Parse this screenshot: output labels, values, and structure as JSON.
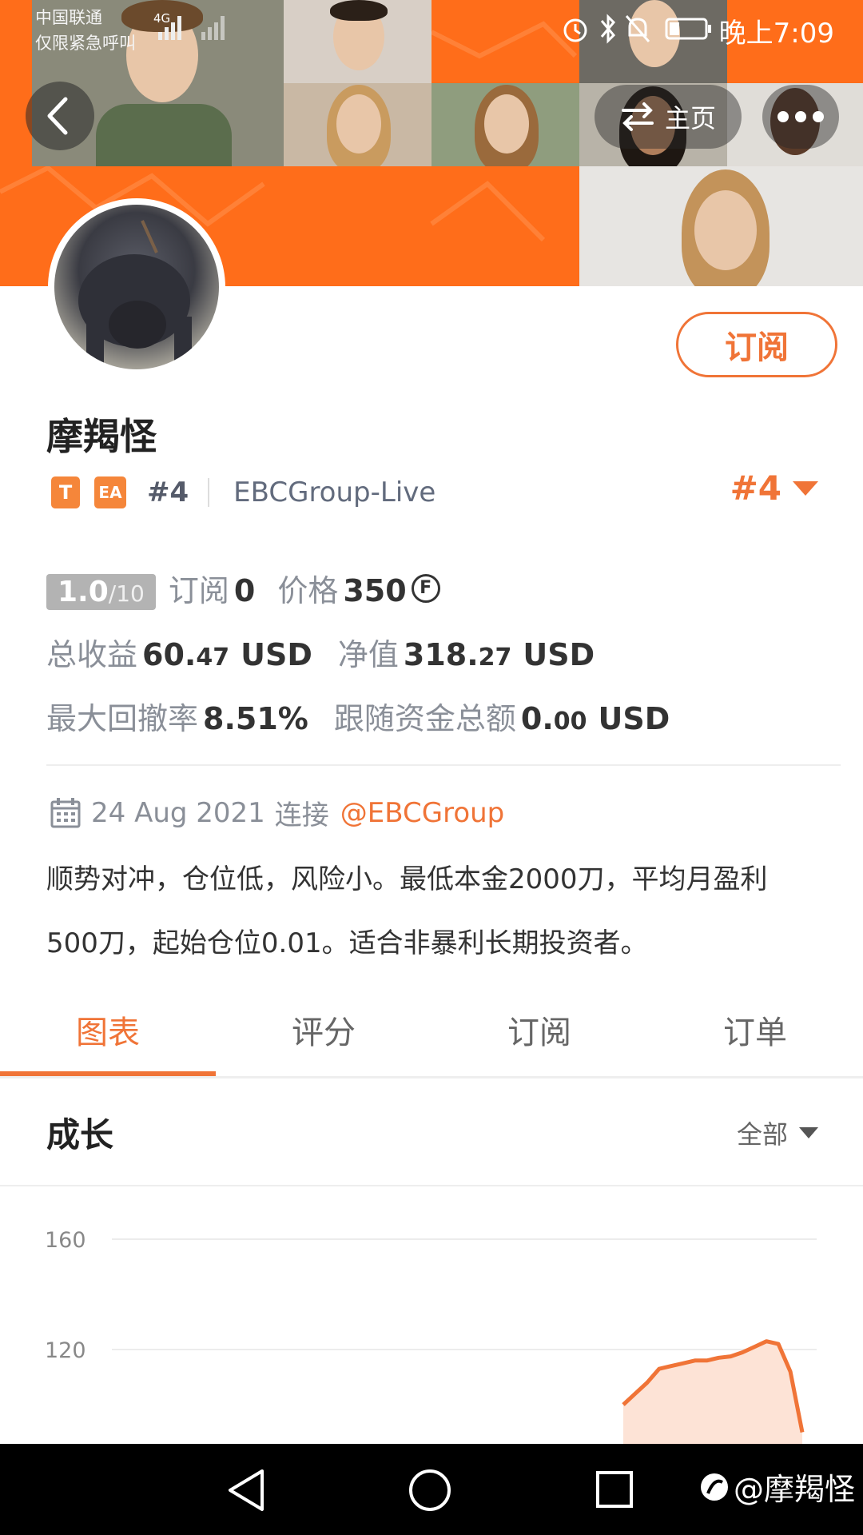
{
  "status_bar": {
    "carrier": "中国联通",
    "emergency": "仅限紧急呼叫",
    "network": "4G",
    "time": "晚上7:09"
  },
  "header": {
    "home_label": "主页"
  },
  "profile": {
    "name": "摩羯怪",
    "badge_t": "T",
    "badge_ea": "EA",
    "rank_small": "#4",
    "server": "EBCGroup-Live",
    "rank_big": "#4",
    "subscribe_label": "订阅"
  },
  "stats": {
    "rating_value": "1.0",
    "rating_max": "/10",
    "subs_label": "订阅",
    "subs_value": "0",
    "price_label": "价格",
    "price_value": "350",
    "coin_symbol": "F",
    "total_profit_label": "总收益",
    "total_profit_int": "60.",
    "total_profit_dec": "47",
    "total_profit_unit": "USD",
    "equity_label": "净值",
    "equity_int": "318.",
    "equity_dec": "27",
    "equity_unit": "USD",
    "drawdown_label": "最大回撤率",
    "drawdown_value": "8.51%",
    "follow_label": "跟随资金总额",
    "follow_int": "0.",
    "follow_dec": "00",
    "follow_unit": "USD"
  },
  "info": {
    "date": "24 Aug 2021",
    "connect_label": "连接",
    "mention": "@EBCGroup",
    "description": "顺势对冲，仓位低，风险小。最低本金2000刀，平均月盈利500刀，起始仓位0.01。适合非暴利长期投资者。"
  },
  "tabs": [
    {
      "label": "图表"
    },
    {
      "label": "评分"
    },
    {
      "label": "订阅"
    },
    {
      "label": "订单"
    }
  ],
  "growth": {
    "title": "成长",
    "filter": "全部"
  },
  "chart_data": {
    "type": "area",
    "y_ticks": [
      "160",
      "120"
    ],
    "ylim": [
      80,
      170
    ],
    "grid": true,
    "color": "#f07437",
    "fill": "#fde3d6",
    "x": [
      0,
      1,
      2,
      3,
      4,
      5,
      6,
      7,
      8,
      9,
      10,
      11,
      12,
      13,
      14,
      15
    ],
    "values": [
      100,
      104,
      108,
      113,
      114,
      115,
      116,
      116,
      117,
      117.5,
      119,
      121,
      123,
      122,
      112,
      90
    ]
  },
  "colors": {
    "accent": "#f07437",
    "banner": "#ff6d1a"
  },
  "watermark": "@摩羯怪"
}
